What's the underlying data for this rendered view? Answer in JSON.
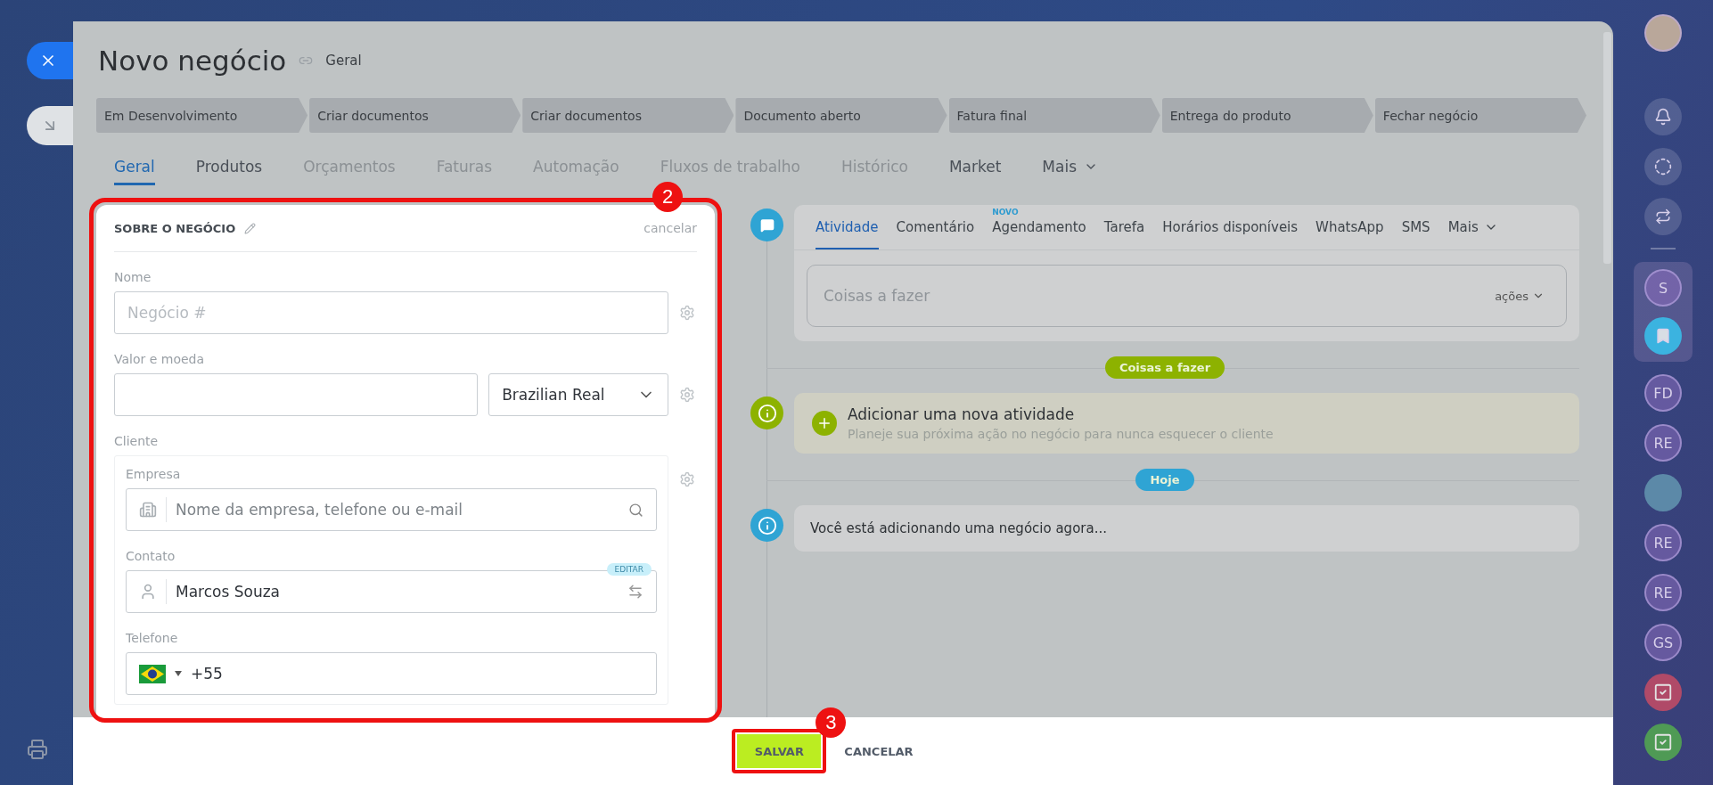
{
  "header": {
    "title": "Novo negócio",
    "subtitle": "Geral"
  },
  "stages": [
    "Em Desenvolvimento",
    "Criar documentos",
    "Criar documentos",
    "Documento aberto",
    "Fatura final",
    "Entrega do produto",
    "Fechar negócio"
  ],
  "tabs": [
    {
      "label": "Geral",
      "selected": true,
      "disabled": false
    },
    {
      "label": "Produtos",
      "selected": false,
      "disabled": false
    },
    {
      "label": "Orçamentos",
      "selected": false,
      "disabled": true
    },
    {
      "label": "Faturas",
      "selected": false,
      "disabled": true
    },
    {
      "label": "Automação",
      "selected": false,
      "disabled": true
    },
    {
      "label": "Fluxos de trabalho",
      "selected": false,
      "disabled": true
    },
    {
      "label": "Histórico",
      "selected": false,
      "disabled": true
    },
    {
      "label": "Market",
      "selected": false,
      "disabled": false
    },
    {
      "label": "Mais",
      "selected": false,
      "disabled": false,
      "dropdown": true
    }
  ],
  "form": {
    "title": "SOBRE O NEGÓCIO",
    "cancel": "cancelar",
    "name": {
      "label": "Nome",
      "placeholder": "Negócio #"
    },
    "amount": {
      "label": "Valor e moeda",
      "currency": "Brazilian Real"
    },
    "client": {
      "label": "Cliente",
      "company": {
        "label": "Empresa",
        "placeholder": "Nome da empresa, telefone ou e-mail"
      },
      "contact": {
        "label": "Contato",
        "value": "Marcos Souza",
        "badge": "EDITAR"
      },
      "phone": {
        "label": "Telefone",
        "value": "+55"
      }
    }
  },
  "activity": {
    "tabs": [
      {
        "label": "Atividade",
        "selected": true
      },
      {
        "label": "Comentário",
        "selected": false
      },
      {
        "label": "Agendamento",
        "selected": false,
        "badge": "NOVO"
      },
      {
        "label": "Tarefa",
        "selected": false
      },
      {
        "label": "Horários disponíveis",
        "selected": false
      },
      {
        "label": "WhatsApp",
        "selected": false
      },
      {
        "label": "SMS",
        "selected": false
      },
      {
        "label": "Mais",
        "selected": false,
        "dropdown": true
      }
    ],
    "placeholder": "Coisas a fazer",
    "actions": "ações"
  },
  "timeline": [
    {
      "kind": "divider",
      "label": "Coisas a fazer",
      "color": "#8db200"
    },
    {
      "kind": "add",
      "title": "Adicionar uma nova atividade",
      "text": "Planeje sua próxima ação no negócio para nunca esquecer o cliente"
    },
    {
      "kind": "divider",
      "label": "Hoje",
      "color": "#2fa4d4"
    },
    {
      "kind": "info",
      "text": "Você está adicionando uma negócio agora..."
    }
  ],
  "footer": {
    "save": "SALVAR",
    "cancel": "CANCELAR"
  },
  "annotations": [
    "2",
    "3"
  ],
  "rail": [
    {
      "kind": "initials",
      "text": "S",
      "pinned": true
    },
    {
      "kind": "bookmark",
      "pinned": true
    },
    {
      "kind": "initials",
      "text": "FD",
      "pinned": false
    },
    {
      "kind": "initials",
      "text": "RE",
      "pinned": false
    },
    {
      "kind": "avatar",
      "pinned": false
    },
    {
      "kind": "initials",
      "text": "RE",
      "pinned": false
    },
    {
      "kind": "initials",
      "text": "RE",
      "pinned": false
    },
    {
      "kind": "initials",
      "text": "GS",
      "pinned": false
    },
    {
      "kind": "task",
      "color": "#b04a68",
      "pinned": false
    },
    {
      "kind": "task",
      "color": "#4f9a55",
      "pinned": false
    }
  ]
}
